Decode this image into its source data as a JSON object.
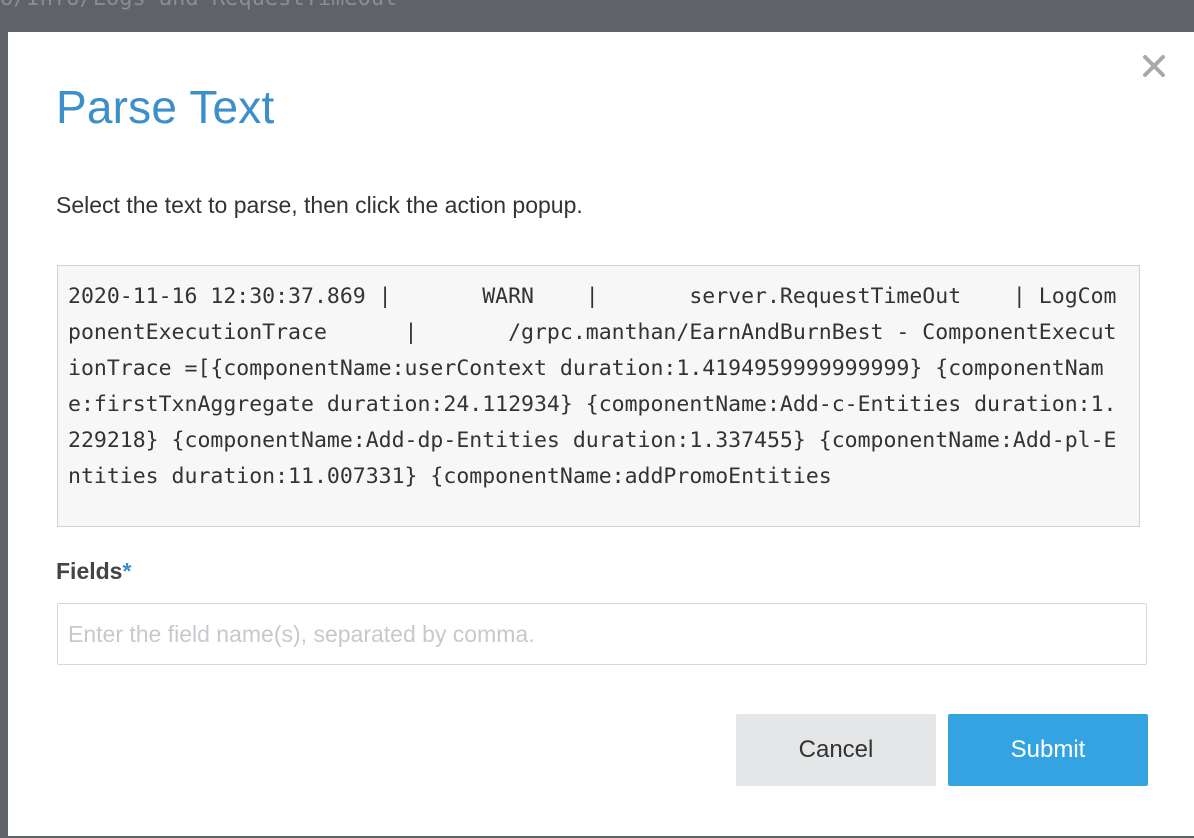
{
  "backdrop": {
    "text": "o/Info/Logs and RequestTimeOut"
  },
  "modal": {
    "title": "Parse Text",
    "instructions": "Select the text to parse, then click the action popup.",
    "log_text": "2020-11-16 12:30:37.869 |       WARN    |       server.RequestTimeOut    | LogComponentExecutionTrace      |       /grpc.manthan/EarnAndBurnBest - ComponentExecutionTrace =[{componentName:userContext duration:1.4194959999999999} {componentName:firstTxnAggregate duration:24.112934} {componentName:Add-c-Entities duration:1.229218} {componentName:Add-dp-Entities duration:1.337455} {componentName:Add-pl-Entities duration:11.007331} {componentName:addPromoEntities",
    "fields": {
      "label": "Fields",
      "required_mark": "*",
      "placeholder": "Enter the field name(s), separated by comma.",
      "value": ""
    },
    "buttons": {
      "cancel_label": "Cancel",
      "submit_label": "Submit"
    }
  },
  "icons": {
    "close": "close-icon"
  },
  "colors": {
    "title": "#3c8fc9",
    "submit": "#34a3e2",
    "cancel": "#e4e6e8",
    "backdrop": "#5f6266"
  }
}
